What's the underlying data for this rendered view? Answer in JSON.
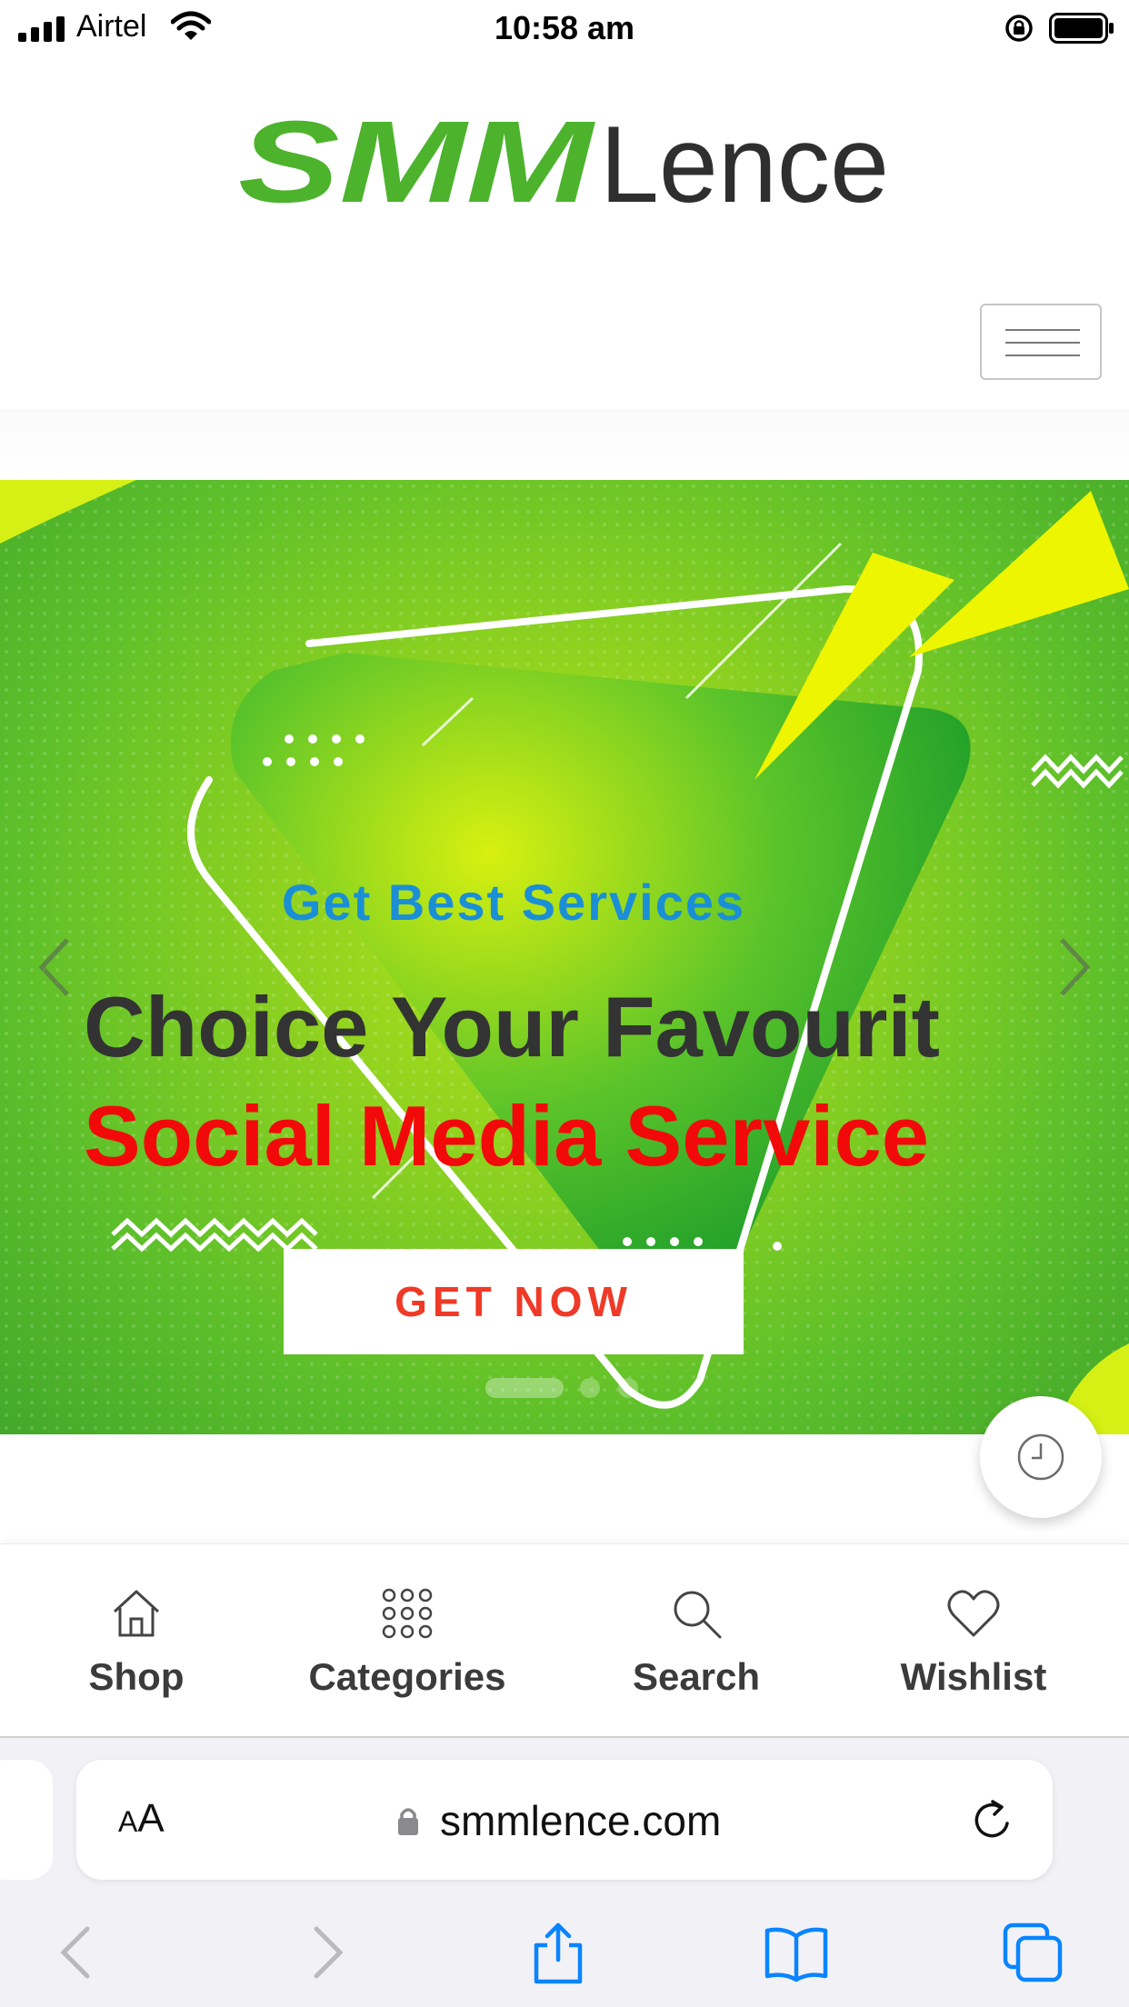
{
  "status_bar": {
    "carrier": "Airtel",
    "time": "10:58 am"
  },
  "header": {
    "logo_text_primary": "SMM",
    "logo_text_secondary": "Lence",
    "colors": {
      "brand_green": "#4db32d",
      "brand_dark": "#2f2f2f"
    }
  },
  "hero": {
    "eyebrow": "Get Best Services",
    "title_line1": "Choice Your Favourit",
    "title_line2": "Social Media Service",
    "cta_label": "GET NOW",
    "slide_count": 3,
    "active_slide": 1,
    "colors": {
      "eyebrow": "#1a8fd6",
      "line1": "#333333",
      "line2": "#f20a0a",
      "cta_text": "#ef3a28"
    }
  },
  "site_nav": {
    "items": [
      {
        "label": "Shop",
        "icon": "home-icon"
      },
      {
        "label": "Categories",
        "icon": "grid-dots-icon"
      },
      {
        "label": "Search",
        "icon": "search-icon"
      },
      {
        "label": "Wishlist",
        "icon": "heart-icon"
      }
    ]
  },
  "browser": {
    "text_size_label_small": "A",
    "text_size_label_large": "A",
    "url": "smmlence.com",
    "accent": "#0a84ff"
  }
}
